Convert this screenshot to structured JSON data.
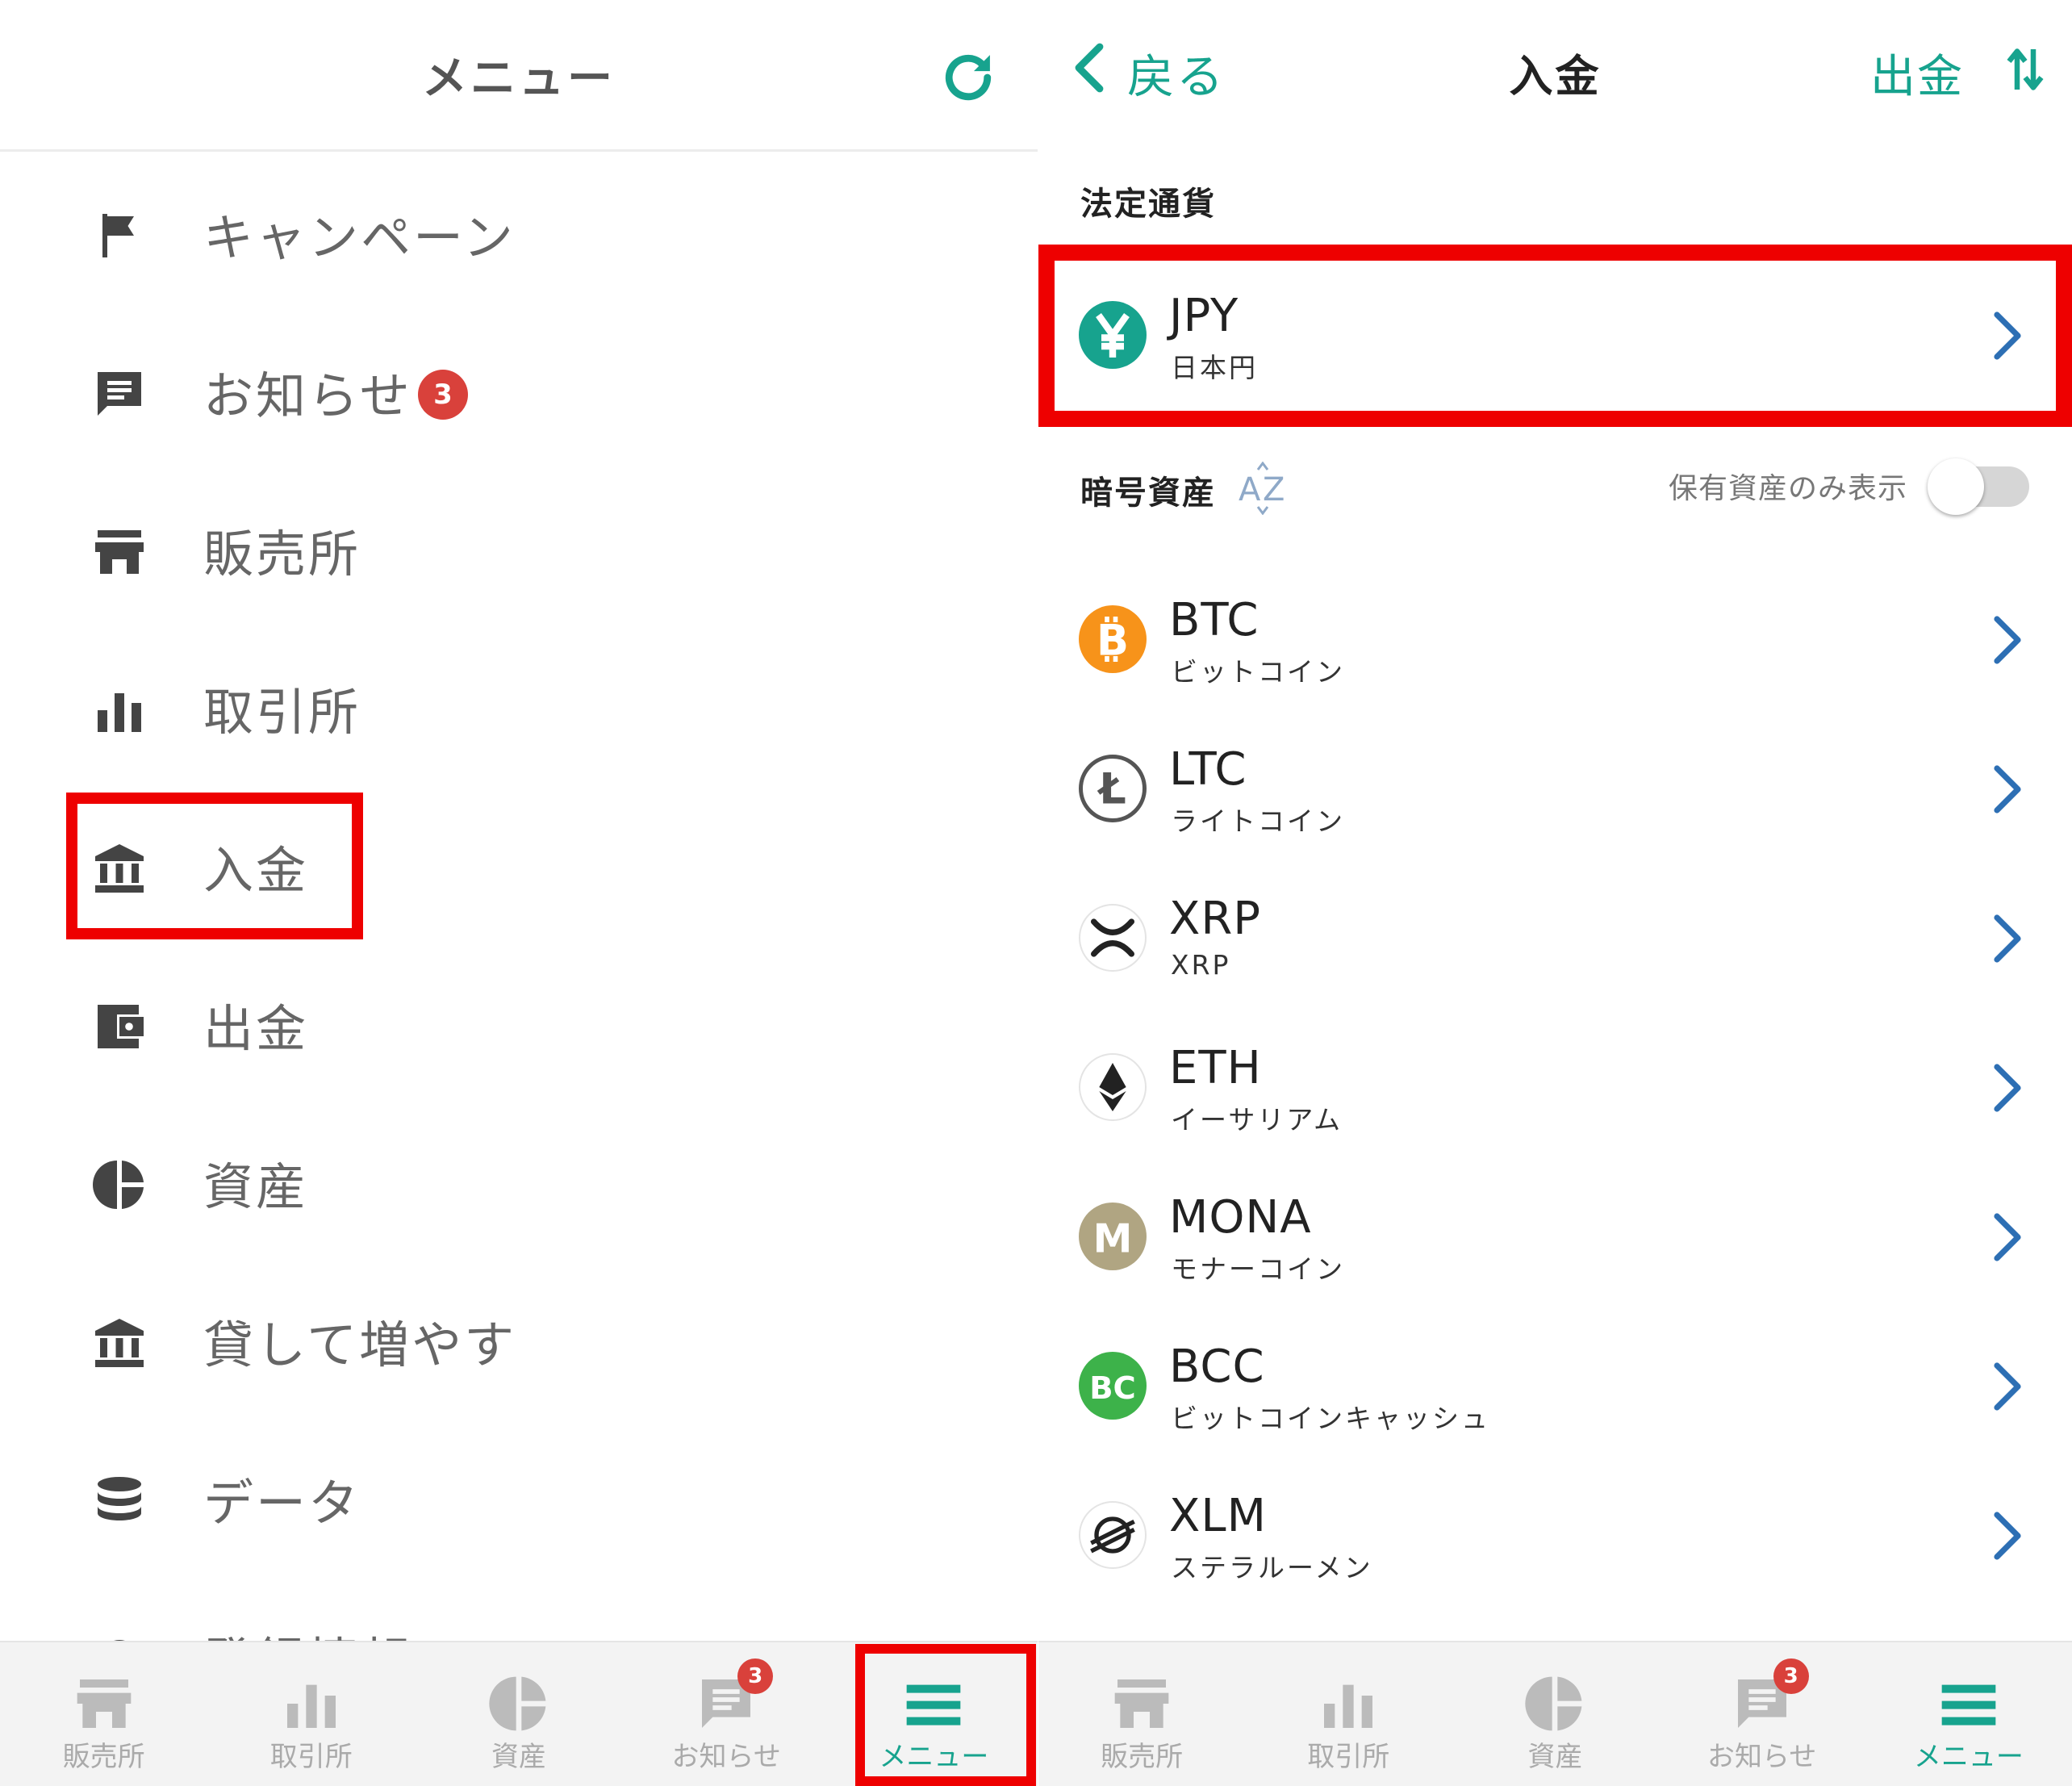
{
  "colors": {
    "accent": "#17a38e",
    "badge": "#d9413b",
    "highlight": "#ee0000",
    "icon_gray": "#444444"
  },
  "left": {
    "title": "メニュー",
    "refresh_icon": "refresh-icon",
    "items": [
      {
        "label": "キャンペーン",
        "icon": "flag-icon"
      },
      {
        "label": "お知らせ",
        "icon": "message-icon",
        "badge": "3"
      },
      {
        "label": "販売所",
        "icon": "store-icon"
      },
      {
        "label": "取引所",
        "icon": "bar-chart-icon"
      },
      {
        "label": "入金",
        "icon": "bank-icon"
      },
      {
        "label": "出金",
        "icon": "wallet-icon"
      },
      {
        "label": "資産",
        "icon": "pie-chart-icon"
      },
      {
        "label": "貸して増やす",
        "icon": "bank-icon"
      },
      {
        "label": "データ",
        "icon": "database-icon"
      },
      {
        "label": "登録情報",
        "icon": "settings-icon"
      }
    ]
  },
  "tabbar": {
    "tabs": [
      {
        "label": "販売所",
        "icon": "store-icon"
      },
      {
        "label": "取引所",
        "icon": "bar-chart-icon"
      },
      {
        "label": "資産",
        "icon": "pie-chart-icon"
      },
      {
        "label": "お知らせ",
        "icon": "message-icon",
        "badge": "3"
      },
      {
        "label": "メニュー",
        "icon": "hamburger-icon",
        "active": true
      }
    ]
  },
  "right": {
    "back_label": "戻る",
    "title": "入金",
    "withdraw_label": "出金",
    "fiat_header": "法定通貨",
    "crypto_header": "暗号資産",
    "sort_icon": "az-sort-icon",
    "holdings_label": "保有資産のみ表示",
    "holdings_toggle_on": false,
    "fiat": [
      {
        "symbol": "JPY",
        "name": "日本円",
        "icon": "yen-icon",
        "color": "#17a38e"
      }
    ],
    "coins": [
      {
        "symbol": "BTC",
        "name": "ビットコイン",
        "icon": "btc-icon",
        "color": "#f7931a"
      },
      {
        "symbol": "LTC",
        "name": "ライトコイン",
        "icon": "ltc-icon",
        "color": "#555555"
      },
      {
        "symbol": "XRP",
        "name": "XRP",
        "icon": "xrp-icon",
        "color": "#222222"
      },
      {
        "symbol": "ETH",
        "name": "イーサリアム",
        "icon": "eth-icon",
        "color": "#222222"
      },
      {
        "symbol": "MONA",
        "name": "モナーコイン",
        "icon": "mona-icon",
        "color": "#b0a582"
      },
      {
        "symbol": "BCC",
        "name": "ビットコインキャッシュ",
        "icon": "bcc-icon",
        "color": "#3db24a"
      },
      {
        "symbol": "XLM",
        "name": "ステラルーメン",
        "icon": "xlm-icon",
        "color": "#222222"
      }
    ]
  }
}
